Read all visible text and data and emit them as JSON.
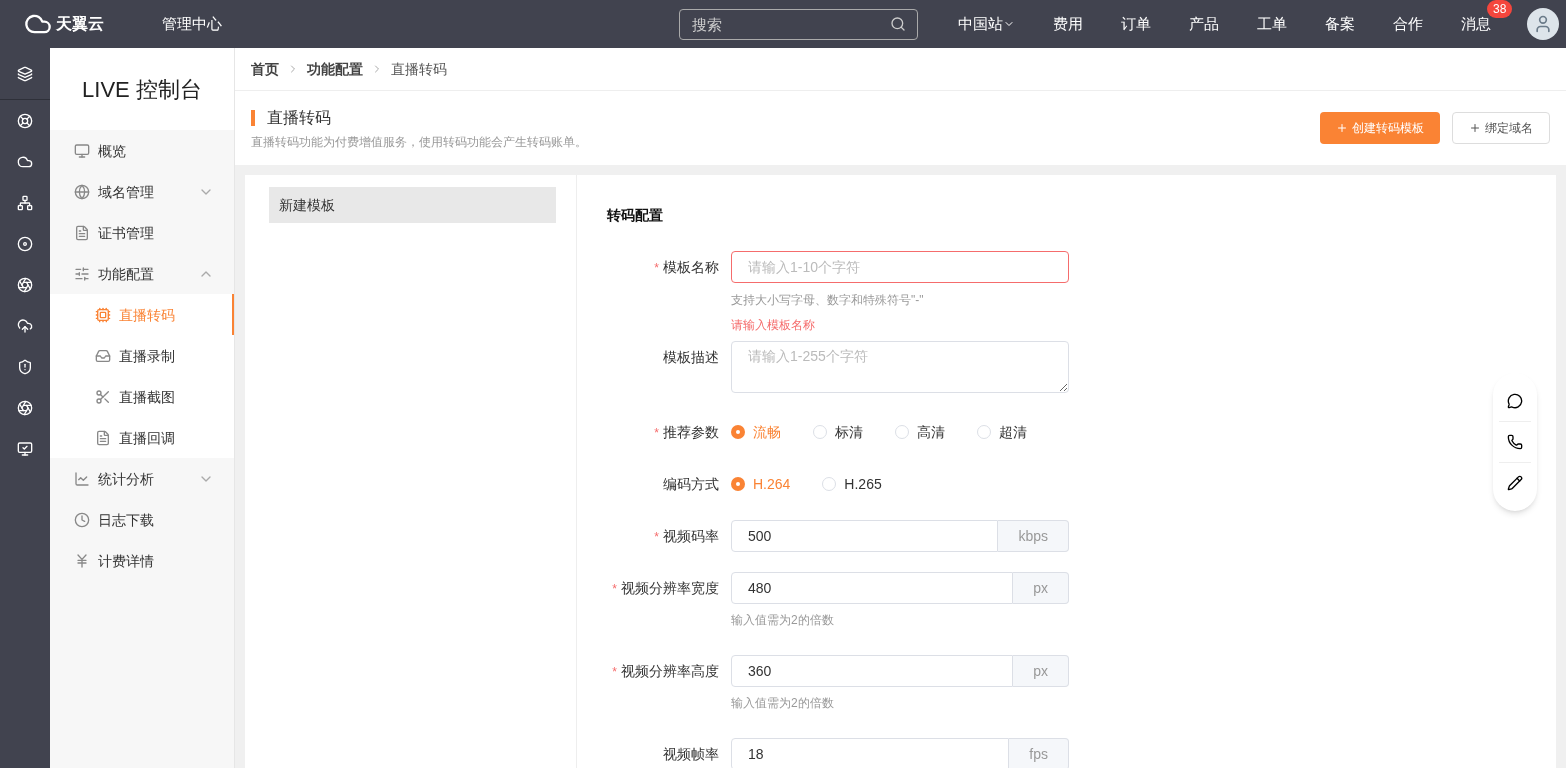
{
  "topbar": {
    "logo_text": "天翼云",
    "title": "管理中心",
    "search": {
      "placeholder": "搜索"
    },
    "nav": [
      {
        "label": "中国站",
        "dropdown": true
      },
      {
        "label": "费用",
        "dropdown": false
      },
      {
        "label": "订单",
        "dropdown": false
      },
      {
        "label": "产品",
        "dropdown": false
      },
      {
        "label": "工单",
        "dropdown": false
      },
      {
        "label": "备案",
        "dropdown": false
      },
      {
        "label": "合作",
        "dropdown": false
      },
      {
        "label": "消息",
        "dropdown": false,
        "badge": "38"
      }
    ]
  },
  "sidebar": {
    "title": "LIVE 控制台",
    "items": [
      {
        "label": "概览",
        "selected": false
      },
      {
        "label": "域名管理",
        "selected": false,
        "expanded": false
      },
      {
        "label": "证书管理",
        "selected": false
      },
      {
        "label": "功能配置",
        "selected": false,
        "expanded": true,
        "children": [
          {
            "label": "直播转码",
            "selected": true
          },
          {
            "label": "直播录制",
            "selected": false
          },
          {
            "label": "直播截图",
            "selected": false
          },
          {
            "label": "直播回调",
            "selected": false
          }
        ]
      },
      {
        "label": "统计分析",
        "selected": false,
        "expanded": false
      },
      {
        "label": "日志下载",
        "selected": false
      },
      {
        "label": "计费详情",
        "selected": false
      }
    ]
  },
  "breadcrumb": [
    "首页",
    "功能配置",
    "直播转码"
  ],
  "page": {
    "title": "直播转码",
    "description": "直播转码功能为付费增值服务，使用转码功能会产生转码账单。",
    "buttons": [
      {
        "label": "创建转码模板",
        "kind": "primary"
      },
      {
        "label": "绑定域名",
        "kind": "default"
      }
    ]
  },
  "templates": [
    {
      "label": "新建模板",
      "selected": true
    }
  ],
  "form": {
    "title": "转码配置",
    "required_mark": "*",
    "fields": [
      {
        "kind": "text",
        "label": "模板名称",
        "required": true,
        "placeholder": "请输入1-10个字符",
        "invalid": true,
        "hint": "支持大小写字母、数字和特殊符号\"-\"",
        "error": "请输入模板名称"
      },
      {
        "kind": "textarea",
        "label": "模板描述",
        "required": false,
        "placeholder": "请输入1-255个字符"
      },
      {
        "kind": "radio",
        "label": "推荐参数",
        "required": true,
        "options": [
          {
            "label": "流畅",
            "selected": true
          },
          {
            "label": "标清",
            "selected": false
          },
          {
            "label": "高清",
            "selected": false
          },
          {
            "label": "超清",
            "selected": false
          }
        ]
      },
      {
        "kind": "radio",
        "label": "编码方式",
        "required": false,
        "options": [
          {
            "label": "H.264",
            "selected": true
          },
          {
            "label": "H.265",
            "selected": false
          }
        ]
      },
      {
        "kind": "addon",
        "label": "视频码率",
        "required": true,
        "value": "500",
        "unit": "kbps"
      },
      {
        "kind": "addon",
        "label": "视频分辨率宽度",
        "required": true,
        "value": "480",
        "unit": "px",
        "hint": "输入值需为2的倍数"
      },
      {
        "kind": "addon",
        "label": "视频分辨率高度",
        "required": true,
        "value": "360",
        "unit": "px",
        "hint": "输入值需为2的倍数"
      },
      {
        "kind": "addon",
        "label": "视频帧率",
        "required": false,
        "value": "18",
        "unit": "fps"
      }
    ]
  }
}
